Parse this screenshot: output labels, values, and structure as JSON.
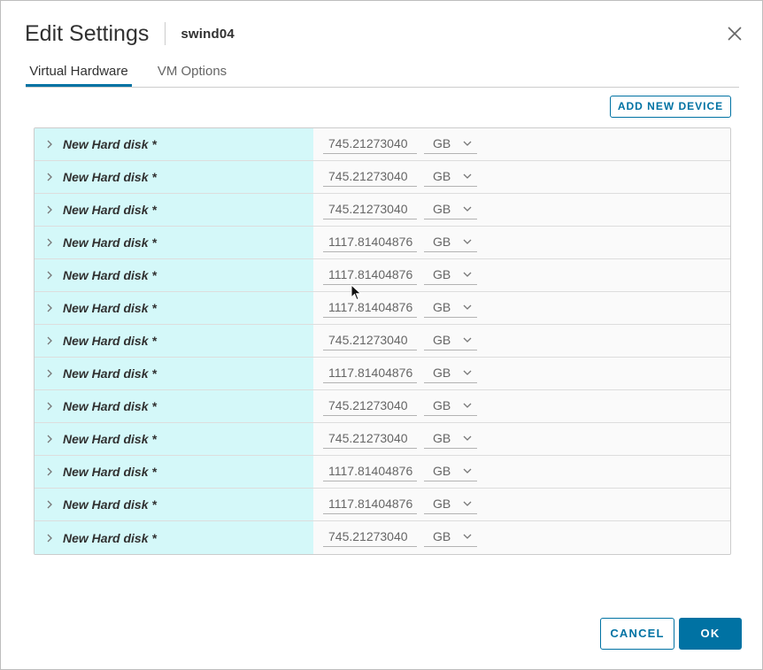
{
  "dialog": {
    "title": "Edit Settings",
    "vm_name": "swind04",
    "close_icon": "close-icon"
  },
  "tabs": [
    {
      "label": "Virtual Hardware",
      "active": true
    },
    {
      "label": "VM Options",
      "active": false
    }
  ],
  "toolbar": {
    "add_device_label": "ADD NEW DEVICE"
  },
  "disks": [
    {
      "label": "New Hard disk *",
      "size": "745.21273040",
      "unit": "GB"
    },
    {
      "label": "New Hard disk *",
      "size": "745.21273040",
      "unit": "GB"
    },
    {
      "label": "New Hard disk *",
      "size": "745.21273040",
      "unit": "GB"
    },
    {
      "label": "New Hard disk *",
      "size": "1117.81404876",
      "unit": "GB"
    },
    {
      "label": "New Hard disk *",
      "size": "1117.81404876",
      "unit": "GB"
    },
    {
      "label": "New Hard disk *",
      "size": "1117.81404876",
      "unit": "GB"
    },
    {
      "label": "New Hard disk *",
      "size": "745.21273040",
      "unit": "GB"
    },
    {
      "label": "New Hard disk *",
      "size": "1117.81404876",
      "unit": "GB"
    },
    {
      "label": "New Hard disk *",
      "size": "745.21273040",
      "unit": "GB"
    },
    {
      "label": "New Hard disk *",
      "size": "745.21273040",
      "unit": "GB"
    },
    {
      "label": "New Hard disk *",
      "size": "1117.81404876",
      "unit": "GB"
    },
    {
      "label": "New Hard disk *",
      "size": "1117.81404876",
      "unit": "GB"
    },
    {
      "label": "New Hard disk *",
      "size": "745.21273040",
      "unit": "GB"
    }
  ],
  "footer": {
    "cancel_label": "CANCEL",
    "ok_label": "OK"
  },
  "colors": {
    "accent": "#0072a3",
    "row_highlight": "#d4f8f9"
  }
}
